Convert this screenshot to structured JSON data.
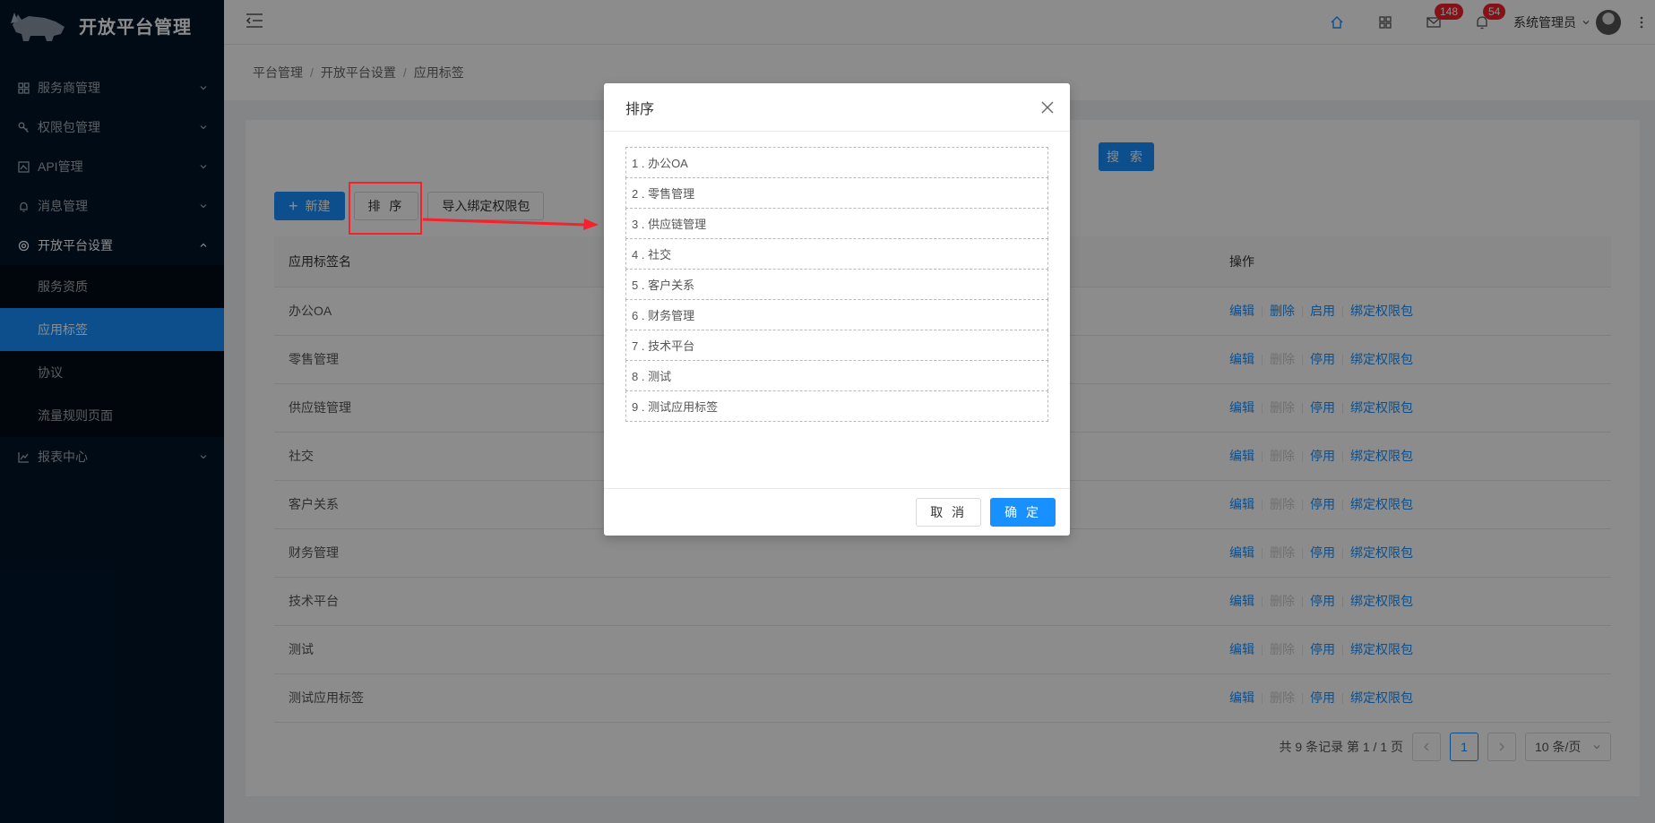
{
  "app": {
    "title": "开放平台管理"
  },
  "sidebar": {
    "items": [
      {
        "label": "服务商管理",
        "icon": "grid-icon"
      },
      {
        "label": "权限包管理",
        "icon": "key-icon"
      },
      {
        "label": "API管理",
        "icon": "api-icon"
      },
      {
        "label": "消息管理",
        "icon": "bell-icon"
      },
      {
        "label": "开放平台设置",
        "icon": "gear-icon",
        "open": true,
        "children": [
          {
            "label": "服务资质"
          },
          {
            "label": "应用标签",
            "active": true
          },
          {
            "label": "协议"
          },
          {
            "label": "流量规则页面"
          }
        ]
      },
      {
        "label": "报表中心",
        "icon": "chart-icon"
      }
    ]
  },
  "header": {
    "mail_badge": "148",
    "bell_badge": "54",
    "user_name": "系统管理员"
  },
  "breadcrumb": [
    "平台管理",
    "开放平台设置",
    "应用标签"
  ],
  "toolbar": {
    "search_label": "搜 索",
    "new_label": "新建",
    "sort_label": "排 序",
    "import_label": "导入绑定权限包"
  },
  "table": {
    "columns": [
      "应用标签名",
      "操作"
    ],
    "rows": [
      {
        "name": "办公OA",
        "toggle": "启用",
        "delete_enabled": true
      },
      {
        "name": "零售管理",
        "toggle": "停用",
        "delete_enabled": false
      },
      {
        "name": "供应链管理",
        "toggle": "停用",
        "delete_enabled": false
      },
      {
        "name": "社交",
        "toggle": "停用",
        "delete_enabled": false
      },
      {
        "name": "客户关系",
        "toggle": "停用",
        "delete_enabled": false
      },
      {
        "name": "财务管理",
        "toggle": "停用",
        "delete_enabled": false
      },
      {
        "name": "技术平台",
        "toggle": "停用",
        "delete_enabled": false
      },
      {
        "name": "测试",
        "toggle": "停用",
        "delete_enabled": false
      },
      {
        "name": "测试应用标签",
        "toggle": "停用",
        "delete_enabled": false
      }
    ],
    "op_edit": "编辑",
    "op_delete": "删除",
    "op_bind": "绑定权限包"
  },
  "pagination": {
    "summary": "共 9 条记录 第 1 / 1 页",
    "current_page": "1",
    "page_size": "10 条/页"
  },
  "modal": {
    "title": "排序",
    "items": [
      "1 . 办公OA",
      "2 . 零售管理",
      "3 . 供应链管理",
      "4 . 社交",
      "5 . 客户关系",
      "6 . 财务管理",
      "7 . 技术平台",
      "8 . 测试",
      "9 . 测试应用标签"
    ],
    "cancel_label": "取 消",
    "ok_label": "确 定"
  },
  "colors": {
    "primary": "#1890ff",
    "sidebar": "#001529",
    "annotation": "#f5222d"
  }
}
